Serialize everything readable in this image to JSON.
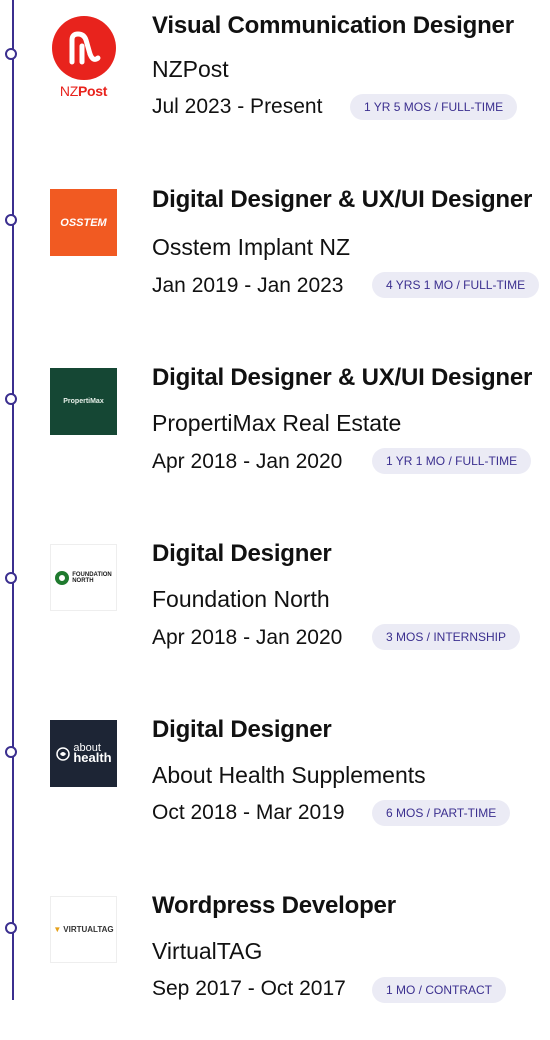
{
  "experiences": [
    {
      "title": "Visual Communication Designer",
      "company": "NZPost",
      "dates": "Jul 2023 - Present",
      "badge": "1 YR 5 MOS / FULL-TIME",
      "logo": {
        "icon": "nzpost-logo",
        "text_a": "NZ",
        "text_b": "Post"
      }
    },
    {
      "title": "Digital Designer & UX/UI Designer",
      "company": "Osstem Implant NZ",
      "dates": "Jan 2019 - Jan 2023",
      "badge": "4 YRS 1 MO / FULL-TIME",
      "logo": {
        "icon": "osstem-logo",
        "text": "OSSTEM"
      }
    },
    {
      "title": "Digital Designer & UX/UI Designer",
      "company": "PropertiMax Real Estate",
      "dates": "Apr 2018 - Jan 2020",
      "badge": "1 YR 1 MO / FULL-TIME",
      "logo": {
        "icon": "propertimax-logo",
        "text": "PropertiMax"
      }
    },
    {
      "title": "Digital Designer",
      "company": "Foundation North",
      "dates": "Apr 2018 - Jan 2020",
      "badge": "3 MOS / INTERNSHIP",
      "logo": {
        "icon": "foundation-north-logo",
        "text_a": "FOUNDATION",
        "text_b": "NORTH"
      }
    },
    {
      "title": "Digital Designer",
      "company": "About Health Supplements",
      "dates": "Oct 2018 - Mar 2019",
      "badge": "6 MOS / PART-TIME",
      "logo": {
        "icon": "about-health-logo",
        "text_a": "about",
        "text_b": "health"
      }
    },
    {
      "title": "Wordpress Developer",
      "company": "VirtualTAG",
      "dates": "Sep 2017 - Oct 2017",
      "badge": "1 MO / CONTRACT",
      "logo": {
        "icon": "virtualtag-logo",
        "text": "VIRTUALTAG"
      }
    }
  ],
  "colors": {
    "timeline": "#3b2f8f",
    "badge_bg": "#ebebf5",
    "badge_text": "#3b2f8f",
    "nzpost_red": "#e8231d",
    "osstem_orange": "#f15a22",
    "propertimax_green": "#154734",
    "about_health_navy": "#1d2535"
  }
}
